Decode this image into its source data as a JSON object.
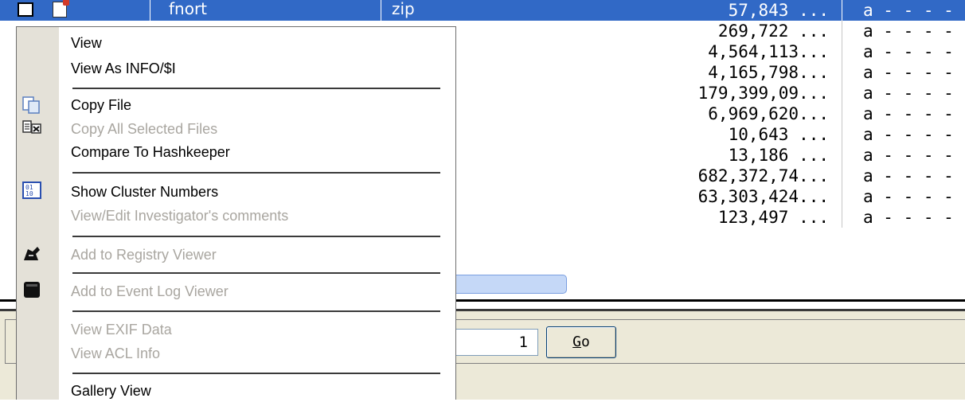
{
  "table": {
    "selected_row": {
      "name": "fnort",
      "ext": "zip",
      "size": "57,843 ...",
      "attr": "a - - - -"
    },
    "rows": [
      {
        "size": "269,722 ...",
        "attr": "a - - - -"
      },
      {
        "size": "4,564,113...",
        "attr": "a - - - -"
      },
      {
        "size": "4,165,798...",
        "attr": "a - - - -"
      },
      {
        "size": "179,399,09...",
        "attr": "a - - - -"
      },
      {
        "size": "6,969,620...",
        "attr": "a - - - -"
      },
      {
        "size": "10,643 ...",
        "attr": "a - - - -"
      },
      {
        "size": "13,186 ...",
        "attr": "a - - - -"
      },
      {
        "size": "682,372,74...",
        "attr": "a - - - -"
      },
      {
        "size": "63,303,424...",
        "attr": "a - - - -"
      },
      {
        "size": "123,497 ...",
        "attr": "a - - - -"
      }
    ]
  },
  "pager": {
    "page_value": "1",
    "go_label_accel": "G",
    "go_label_rest": "o"
  },
  "context_menu": {
    "view": "View",
    "view_as_info": "View As INFO/$I",
    "copy_file": "Copy File",
    "copy_all_selected": "Copy All Selected Files",
    "compare_hashkeeper": "Compare To Hashkeeper",
    "show_cluster_numbers": "Show Cluster Numbers",
    "view_edit_comments": "View/Edit Investigator's comments",
    "add_registry_viewer": "Add to Registry Viewer",
    "add_event_log_viewer": "Add to Event Log Viewer",
    "view_exif": "View EXIF Data",
    "view_acl": "View ACL Info",
    "gallery_view": "Gallery View"
  },
  "colors": {
    "selection": "#3169c6",
    "menu_strip": "#e4e1d8",
    "disabled_text": "#a9a6a0",
    "panel_bg": "#ece9d8"
  }
}
